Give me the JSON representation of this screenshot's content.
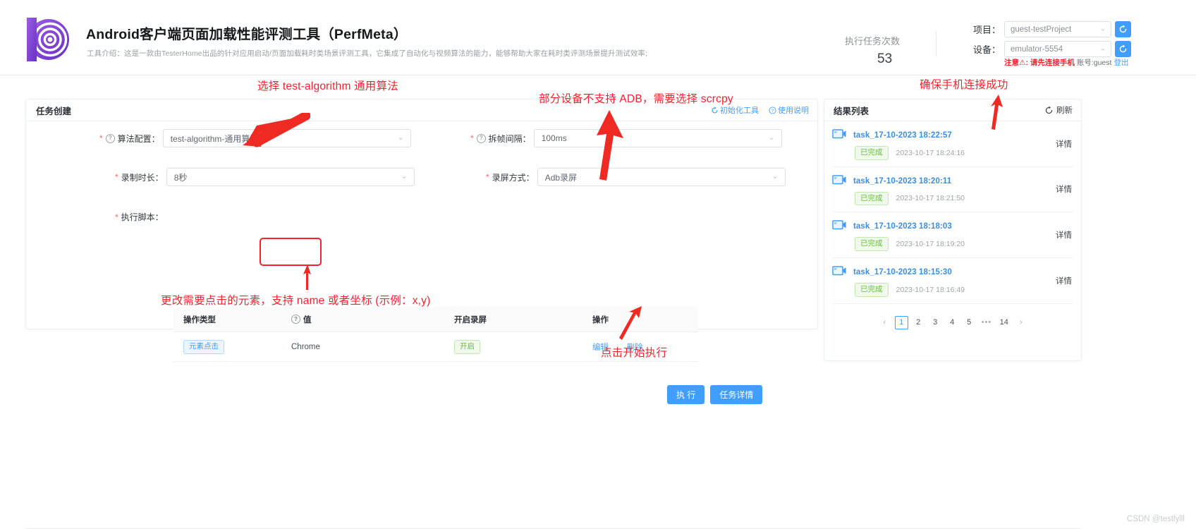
{
  "header": {
    "logo_icon": "concentric-circles-logo",
    "title": "Android客户端页面加载性能评测工具（PerfMeta）",
    "subtitle": "工具介绍：这是一款由TesterHome出品的针对应用启动/页面加载耗时类场景评测工具，它集成了自动化与视频算法的能力，能够帮助大家在耗时类评测场景提升测试效率;",
    "exec_count_label": "执行任务次数",
    "exec_count_value": "53",
    "project": {
      "label": "项目：",
      "value": "guest-testProject",
      "refresh_icon": "refresh-icon"
    },
    "device": {
      "label": "设备：",
      "value": "emulator-5554",
      "refresh_icon": "refresh-icon"
    },
    "notice": {
      "warning": "注意⚠: 请先连接手机",
      "account": "账号:guest",
      "logout": "登出"
    }
  },
  "task_panel": {
    "title": "任务创建",
    "links": [
      {
        "label": "初始化工具",
        "icon": "refresh-icon"
      },
      {
        "label": "使用说明",
        "icon": "question-icon"
      }
    ],
    "fields": [
      {
        "label": "算法配置：",
        "value": "test-algorithm-通用算法",
        "required": true,
        "has_help": true
      },
      {
        "label": "拆帧间隔：",
        "value": "100ms",
        "required": true,
        "has_help": true
      },
      {
        "label": "录制时长：",
        "value": "8秒",
        "required": true,
        "has_help": false
      },
      {
        "label": "录屏方式：",
        "value": "Adb录屏",
        "required": true,
        "has_help": false
      }
    ],
    "script_label": "执行脚本：",
    "script_table": {
      "columns": [
        "操作类型",
        "值",
        "开启录屏",
        "操作"
      ],
      "value_col_has_help": true,
      "rows": [
        {
          "op_type": "元素点击",
          "value": "Chrome",
          "record": "开启",
          "actions": [
            "编辑",
            "删除"
          ]
        }
      ]
    },
    "buttons": [
      {
        "label": "执 行",
        "name": "execute-button"
      },
      {
        "label": "任务详情",
        "name": "task-detail-button"
      }
    ]
  },
  "result_panel": {
    "title": "结果列表",
    "refresh_label": "刷新",
    "refresh_icon": "refresh-icon",
    "detail_label": "详情",
    "status_label": "已完成",
    "items": [
      {
        "name": "task_17-10-2023 18:22:57",
        "status": "已完成",
        "time": "2023-10-17 18:24:16"
      },
      {
        "name": "task_17-10-2023 18:20:11",
        "status": "已完成",
        "time": "2023-10-17 18:21:50"
      },
      {
        "name": "task_17-10-2023 18:18:03",
        "status": "已完成",
        "time": "2023-10-17 18:19:20"
      },
      {
        "name": "task_17-10-2023 18:15:30",
        "status": "已完成",
        "time": "2023-10-17 18:16:49"
      }
    ],
    "pagination": {
      "prev": "‹",
      "pages": [
        "1",
        "2",
        "3",
        "4",
        "5"
      ],
      "dots": "•••",
      "last": "14",
      "next": "›",
      "current": "1"
    }
  },
  "annotations": [
    {
      "id": "anno-algorithm",
      "text": "选择 test-algorithm 通用算法"
    },
    {
      "id": "anno-adb",
      "text": "部分设备不支持 ADB，需要选择 scrcpy"
    },
    {
      "id": "anno-phone",
      "text": "确保手机连接成功"
    },
    {
      "id": "anno-element",
      "text": "更改需要点击的元素，支持 name 或者坐标 (示例：x,y)"
    },
    {
      "id": "anno-execute",
      "text": "点击开始执行"
    }
  ],
  "watermark": "CSDN @testlylll",
  "colors": {
    "accent": "#409eff",
    "annotation_red": "#f5222d",
    "success_green": "#67c23a",
    "logo_purple": "#7b3fd4"
  }
}
